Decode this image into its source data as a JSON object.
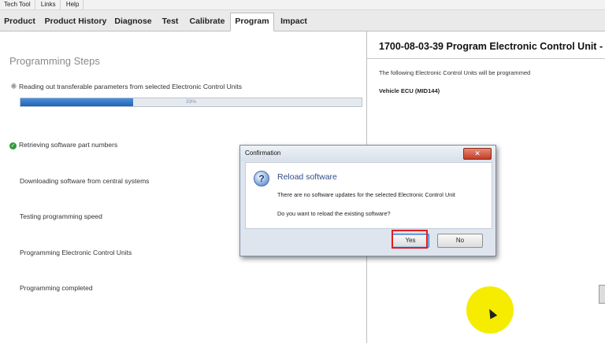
{
  "menubar": {
    "items": [
      "Tech Tool",
      "Links",
      "Help"
    ]
  },
  "tabs": [
    "Product",
    "Product History",
    "Diagnose",
    "Test",
    "Calibrate",
    "Program",
    "Impact"
  ],
  "active_tab": "Program",
  "left": {
    "title": "Programming Steps",
    "progress": {
      "value_percent": 33,
      "label": "33%"
    },
    "steps": [
      {
        "label": "Reading out transferable parameters from selected Electronic Control Units",
        "status": "in-progress",
        "icon": "spinner-icon"
      },
      {
        "label": "Retrieving software part numbers",
        "status": "done",
        "icon": "check-icon"
      },
      {
        "label": "Downloading software from central systems",
        "status": "pending"
      },
      {
        "label": "Testing programming speed",
        "status": "pending"
      },
      {
        "label": "Programming Electronic Control Units",
        "status": "pending"
      },
      {
        "label": "Programming completed",
        "status": "pending"
      }
    ]
  },
  "right": {
    "title": "1700-08-03-39 Program Electronic Control Unit -",
    "desc": "The following Electronic Control Units will be programmed",
    "ecu": "Vehicle ECU (MID144)"
  },
  "dialog": {
    "title": "Confirmation",
    "close_label": "✕",
    "heading": "Reload software",
    "message": "There are no software updates for the selected Electronic Control Unit",
    "question": "Do you want to reload the existing software?",
    "yes_label": "Yes",
    "no_label": "No"
  },
  "colors": {
    "progress_fill": "#1f63b8",
    "highlight": "#e01e1e",
    "cursor_halo": "#f5ec00",
    "heading_blue": "#2f4f86"
  }
}
